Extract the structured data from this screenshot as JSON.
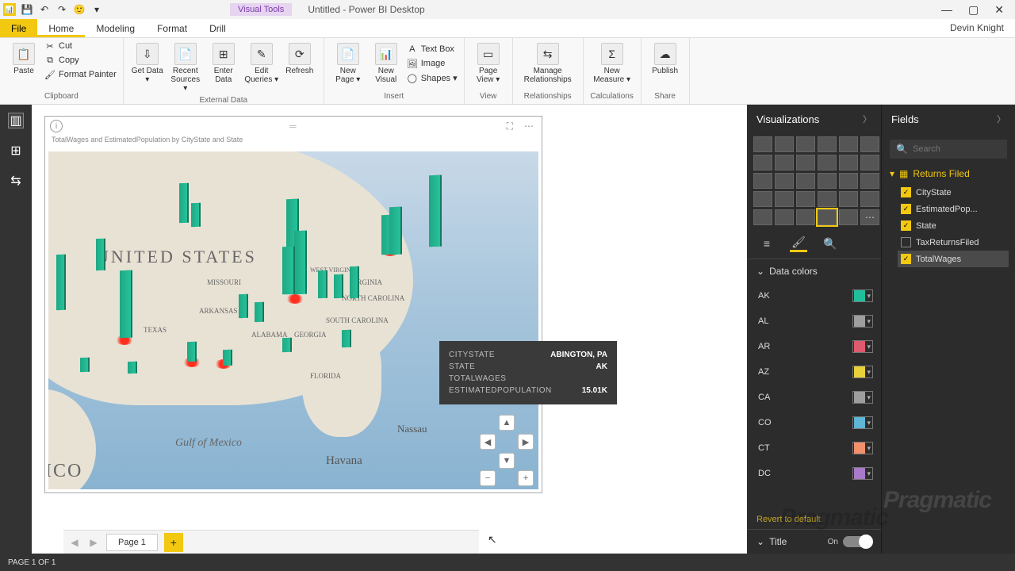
{
  "titlebar": {
    "contextual": "Visual Tools",
    "title": "Untitled - Power BI Desktop"
  },
  "tabs": {
    "file": "File",
    "items": [
      "Home",
      "Modeling",
      "Format",
      "Drill"
    ],
    "user": "Devin Knight"
  },
  "ribbon": {
    "paste": "Paste",
    "cut": "Cut",
    "copy": "Copy",
    "format_painter": "Format Painter",
    "clipboard": "Clipboard",
    "get_data": "Get Data ▾",
    "recent_sources": "Recent Sources ▾",
    "enter_data": "Enter Data",
    "edit_queries": "Edit Queries ▾",
    "refresh": "Refresh",
    "external_data": "External Data",
    "new_page": "New Page ▾",
    "new_visual": "New Visual",
    "text_box": "Text Box",
    "image": "Image",
    "shapes": "Shapes ▾",
    "insert": "Insert",
    "page_view": "Page View ▾",
    "view": "View",
    "manage_rel": "Manage Relationships",
    "relationships": "Relationships",
    "new_measure": "New Measure ▾",
    "calculations": "Calculations",
    "publish": "Publish",
    "share": "Share"
  },
  "visual": {
    "title": "TotalWages and EstimatedPopulation by CityState and State"
  },
  "map_labels": {
    "us": "UNITED STATES",
    "gulf": "Gulf of Mexico",
    "nassau": "Nassau",
    "havana": "Havana",
    "florida": "FLORIDA",
    "sc": "SOUTH CAROLINA",
    "ga": "GEORGIA",
    "al": "ALABAMA",
    "nc": "NORTH CAROLINA",
    "va": "VIRGINIA",
    "wv": "WEST VIRGINIA",
    "mo": "MISSOURI",
    "ar": "ARKANSAS",
    "tx": "TEXAS",
    "ico": "ICO"
  },
  "tooltip": {
    "k0": "CITYSTATE",
    "v0": "ABINGTON, PA",
    "k1": "STATE",
    "v1": "AK",
    "k2": "TOTALWAGES",
    "v2": "",
    "k3": "ESTIMATEDPOPULATION",
    "v3": "15.01K"
  },
  "viz_pane": {
    "header": "Visualizations",
    "accordion": "Data colors",
    "revert": "Revert to default",
    "title_label": "Title",
    "title_on": "On"
  },
  "colors": [
    {
      "label": "AK",
      "hex": "#1fbf9c"
    },
    {
      "label": "AL",
      "hex": "#9e9e9e"
    },
    {
      "label": "AR",
      "hex": "#e05a6d"
    },
    {
      "label": "AZ",
      "hex": "#e8d13b"
    },
    {
      "label": "CA",
      "hex": "#9e9e9e"
    },
    {
      "label": "CO",
      "hex": "#5fb6d6"
    },
    {
      "label": "CT",
      "hex": "#f2906b"
    },
    {
      "label": "DC",
      "hex": "#a87ac9"
    }
  ],
  "fields_pane": {
    "header": "Fields",
    "search": "Search",
    "table": "Returns Filed",
    "items": [
      {
        "label": "CityState",
        "on": true
      },
      {
        "label": "EstimatedPop...",
        "on": true
      },
      {
        "label": "State",
        "on": true
      },
      {
        "label": "TaxReturnsFiled",
        "on": false
      },
      {
        "label": "TotalWages",
        "on": true
      }
    ]
  },
  "pagebar": {
    "page1": "Page 1"
  },
  "status": "PAGE 1 OF 1",
  "watermark": "Pragmatic"
}
